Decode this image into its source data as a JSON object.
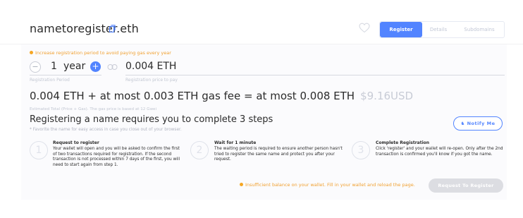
{
  "header": {
    "domain_name": "nametoregister.eth",
    "tabs": [
      {
        "label": "Register",
        "active": true
      },
      {
        "label": "Details",
        "active": false
      },
      {
        "label": "Subdomains",
        "active": false
      }
    ]
  },
  "registration": {
    "tip": "Increase registration period to avoid paying gas every year",
    "period_value": "1",
    "period_unit": "year",
    "period_label": "Registration Period",
    "price_value": "0.004 ETH",
    "price_label": "Registration price to pay",
    "total_line": "0.004 ETH + at most 0.003 ETH gas fee = at most 0.008 ETH",
    "total_usd": "$9.16USD",
    "estimate_note": "Estimated Total (Price + Gas). The gas price is based at 12 Gwei"
  },
  "steps": {
    "title": "Registering a name requires you to complete 3 steps",
    "favorite_note": "* Favorite the name for easy access in case you close out of your browser.",
    "notify_label": "Notify Me",
    "items": [
      {
        "number": "1",
        "title": "Request to register",
        "text": "Your wallet will open and you will be asked to confirm the first of two transactions required for registration. If the second transaction is not processed within 7 days of the first, you will need to start again from step 1."
      },
      {
        "number": "2",
        "title": "Wait for 1 minute",
        "text": "The waiting period is required to ensure another person hasn't tried to register the same name and protect you after your request."
      },
      {
        "number": "3",
        "title": "Complete Registration",
        "text": "Click 'register' and your wallet will re-open. Only after the 2nd transaction is confirmed you'll know if you got the name."
      }
    ]
  },
  "footer": {
    "insufficient_message": "Insufficient balance on your wallet. Fill in your wallet and reload the page.",
    "request_button": "Request To Register"
  },
  "colors": {
    "accent": "#5284ff",
    "warning": "#f5a623",
    "disabled": "#dcdde2"
  }
}
